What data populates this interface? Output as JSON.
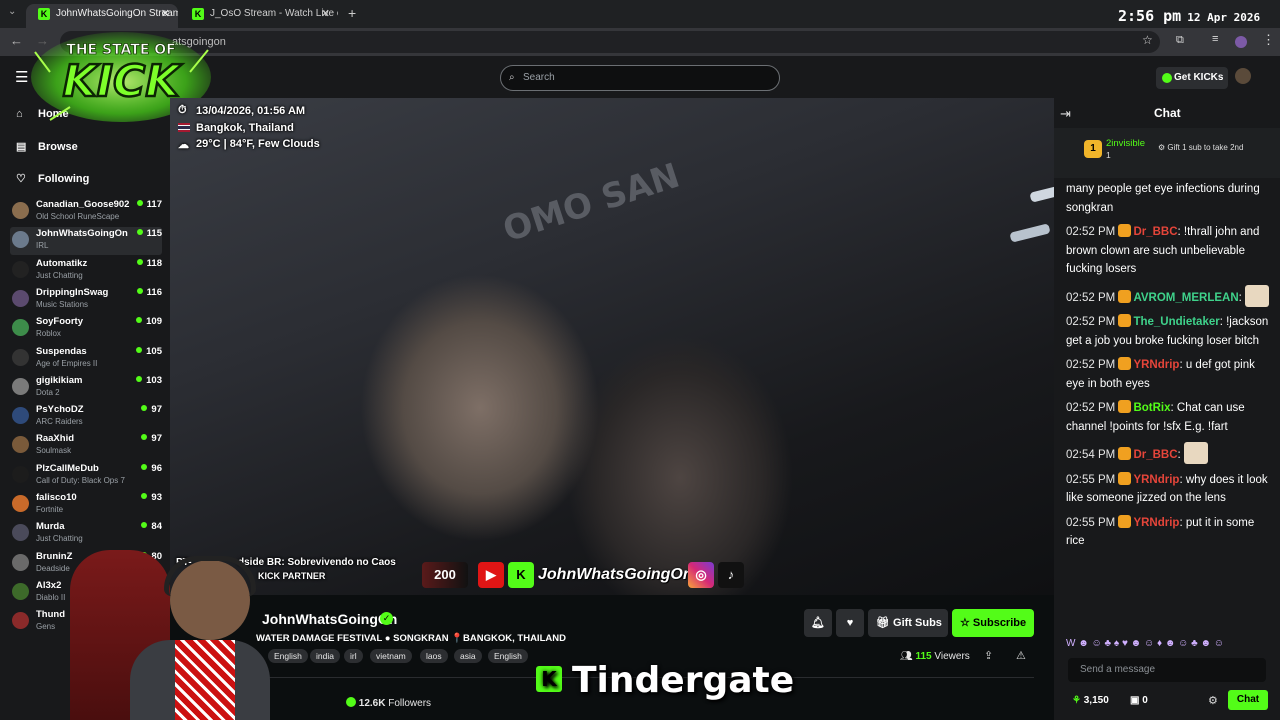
{
  "browser": {
    "tabs": [
      {
        "title": "JohnWhatsGoingOn Stream"
      },
      {
        "title": "J_OsO Stream - Watch Live on K"
      }
    ],
    "url": "atsgoingon",
    "clock": {
      "time": "2:56 pm",
      "date": "12 Apr 2026"
    }
  },
  "header": {
    "search_placeholder": "Search",
    "get_kicks_label": "Get KICKs",
    "logo_text_top": "THE STATE OF",
    "logo_text_main": "KICK"
  },
  "sidebar": {
    "nav": [
      {
        "label": "Home"
      },
      {
        "label": "Browse"
      },
      {
        "label": "Following"
      }
    ],
    "following": [
      {
        "name": "Canadian_Goose902",
        "category": "Old School RuneScape",
        "viewers": "117",
        "color": "#8a6d4e"
      },
      {
        "name": "JohnWhatsGoingOn",
        "category": "IRL",
        "viewers": "115",
        "color": "#6b7a8c"
      },
      {
        "name": "Automatikz",
        "category": "Just Chatting",
        "viewers": "118",
        "color": "#222222"
      },
      {
        "name": "DrippingInSwag",
        "category": "Music Stations",
        "viewers": "116",
        "color": "#5b4a6e"
      },
      {
        "name": "SoyFoorty",
        "category": "Roblox",
        "viewers": "109",
        "color": "#3d8c4a"
      },
      {
        "name": "Suspendas",
        "category": "Age of Empires II",
        "viewers": "105",
        "color": "#333333"
      },
      {
        "name": "gigikikiam",
        "category": "Dota 2",
        "viewers": "103",
        "color": "#7a7a7a"
      },
      {
        "name": "PsYchoDZ",
        "category": "ARC Raiders",
        "viewers": "97",
        "color": "#2e4a7a"
      },
      {
        "name": "RaaXhid",
        "category": "Soulmask",
        "viewers": "97",
        "color": "#7a5a3a"
      },
      {
        "name": "PlzCallMeDub",
        "category": "Call of Duty: Black Ops 7",
        "viewers": "96",
        "color": "#1c1c1c"
      },
      {
        "name": "falisco10",
        "category": "Fortnite",
        "viewers": "93",
        "color": "#c86a2a"
      },
      {
        "name": "Murda",
        "category": "Just Chatting",
        "viewers": "84",
        "color": "#4a4a5a"
      },
      {
        "name": "BruninZ",
        "category": "Deadside",
        "viewers": "80",
        "color": "#6a6a6a"
      },
      {
        "name": "Al3x2",
        "category": "Diablo II",
        "viewers": "",
        "color": "#3d6a2a"
      },
      {
        "name": "Thund",
        "category": "Gens",
        "viewers": "",
        "color": "#8a2a2a"
      }
    ]
  },
  "video": {
    "overlay_datetime": "13/04/2026, 01:56 AM",
    "overlay_location": "Bangkok, Thailand",
    "overlay_weather": "29°C | 84°F, Few Clouds",
    "sign_text": "OMO SAN",
    "bottom_ticker": "PT-",
    "bottom_ticker_2": "dside BR: Sobrevivendo no Caos",
    "partner_text": "KICK PARTNER",
    "social_count": "200",
    "social_handle": "JohnWhatsGoingOn"
  },
  "stream": {
    "streamer_name": "JohnWhatsGoingOn",
    "title": "WATER DAMAGE FESTIVAL ● SONGKRAN 📍BANGKOK, THAILAND",
    "tags": [
      "English",
      "india",
      "irl",
      "vietnam",
      "laos",
      "asia",
      "English"
    ],
    "viewers": "115",
    "viewers_label": "Viewers",
    "followers": "12.6K",
    "followers_label": "Followers",
    "gift_subs_label": "Gift Subs",
    "subscribe_label": "Subscribe"
  },
  "chat": {
    "title": "Chat",
    "pinned": {
      "user": "2invisible",
      "count": "1",
      "prompt": "Gift 1 sub to take 2nd"
    },
    "messages": [
      {
        "time": "",
        "user": "",
        "user_color": "#ffffff",
        "text": "many people get eye infections during songkran"
      },
      {
        "time": "02:52 PM",
        "user": "Dr_BBC",
        "user_color": "#e5453a",
        "text": "!thrall john and brown clown are such unbelievable fucking losers"
      },
      {
        "time": "02:52 PM",
        "user": "AVROM_MERLEAN",
        "user_color": "#3fd28b",
        "text": ""
      },
      {
        "time": "02:52 PM",
        "user": "The_Undietaker",
        "user_color": "#3fd28b",
        "text": "!jackson get a job you broke fucking loser bitch"
      },
      {
        "time": "02:52 PM",
        "user": "YRNdrip",
        "user_color": "#e5453a",
        "text": "u def got pink eye in both eyes"
      },
      {
        "time": "02:52 PM",
        "user": "BotRix",
        "user_color": "#53fc18",
        "text": "Chat can use channel !points for !sfx E.g. !fart"
      },
      {
        "time": "02:54 PM",
        "user": "Dr_BBC",
        "user_color": "#e5453a",
        "text": ""
      },
      {
        "time": "02:55 PM",
        "user": "YRNdrip",
        "user_color": "#e5453a",
        "text": "why does it look like someone jizzed on the lens"
      },
      {
        "time": "02:55 PM",
        "user": "YRNdrip",
        "user_color": "#e5453a",
        "text": "put it in some rice"
      }
    ],
    "send_placeholder": "Send a message",
    "points": "3,150",
    "count2": "0",
    "chat_button": "Chat"
  },
  "caption": {
    "text": "Tindergate"
  },
  "colors": {
    "accent": "#53fc18",
    "bg": "#0b0e0f",
    "panel": "#18191b"
  }
}
